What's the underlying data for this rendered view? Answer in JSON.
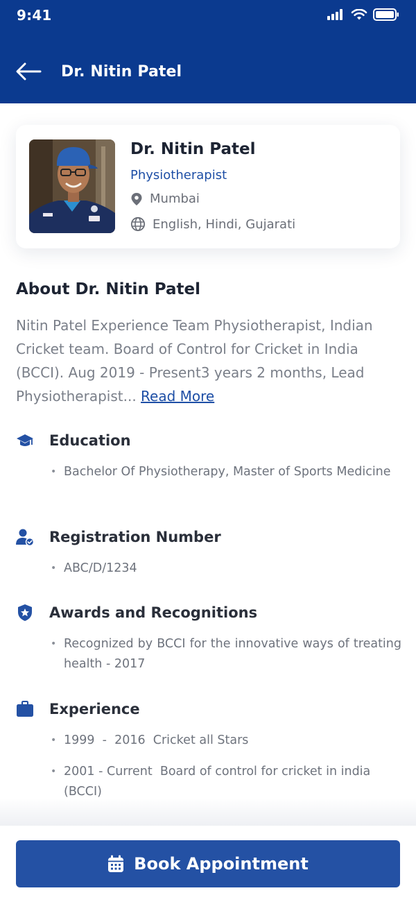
{
  "status_bar": {
    "time": "9:41"
  },
  "header": {
    "title": "Dr. Nitin Patel"
  },
  "doctor": {
    "name": "Dr. Nitin Patel",
    "specialty": "Physiotherapist",
    "location": "Mumbai",
    "languages": "English, Hindi, Gujarati"
  },
  "about": {
    "title": "About Dr. Nitin Patel",
    "text": "Nitin Patel Experience Team Physiotherapist, Indian Cricket team. Board of Control for Cricket in India (BCCI). Aug 2019 - Present3 years 2 months, Lead Physiotherapist...",
    "read_more": "Read More"
  },
  "sections": {
    "education": {
      "title": "Education",
      "items": [
        "Bachelor Of Physiotherapy, Master of Sports Medicine"
      ]
    },
    "registration": {
      "title": "Registration Number",
      "items": [
        "ABC/D/1234"
      ]
    },
    "awards": {
      "title": "Awards and Recognitions",
      "items": [
        "Recognized by BCCI for the innovative ways of treating health - 2017"
      ]
    },
    "experience": {
      "title": "Experience",
      "items": [
        "1999  -  2016  Cricket all Stars",
        "2001 - Current  Board of control for cricket in india (BCCI)"
      ]
    }
  },
  "footer": {
    "book_label": "Book Appointment"
  },
  "colors": {
    "primary": "#0b3a8f",
    "accent": "#1e4fa6",
    "button": "#2451a4"
  }
}
